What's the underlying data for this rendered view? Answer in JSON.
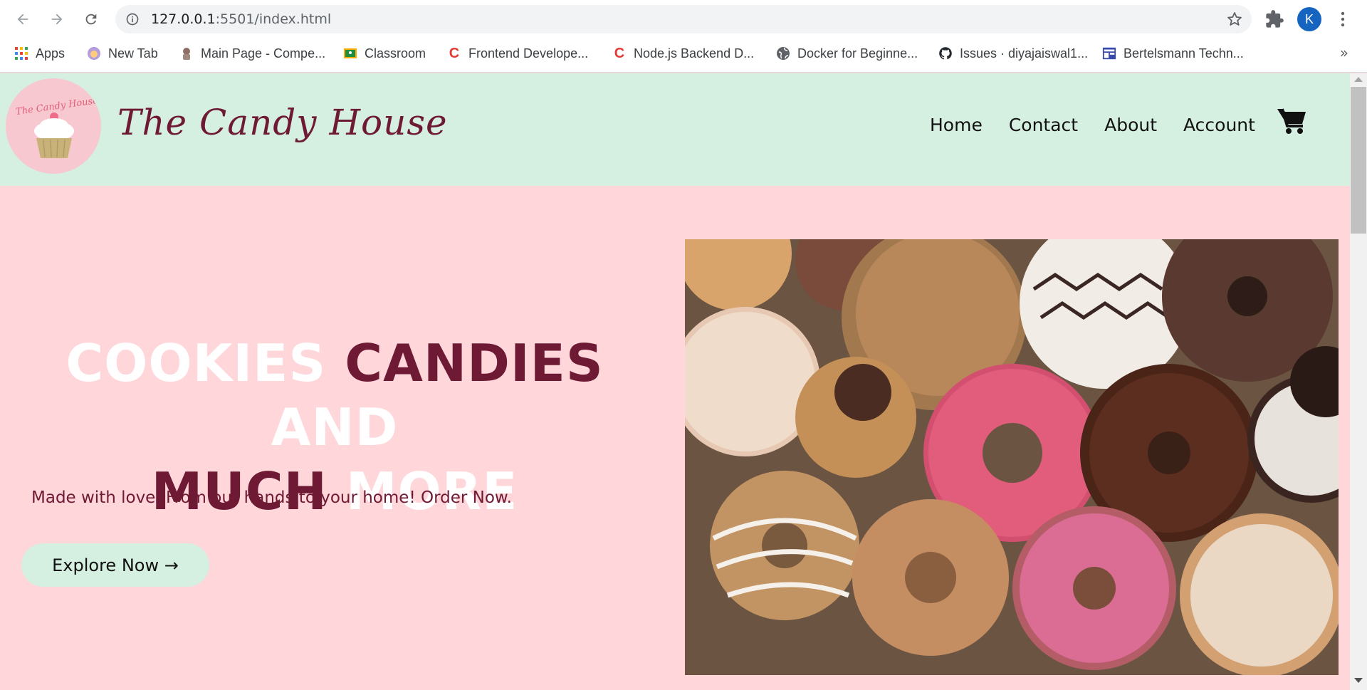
{
  "browser": {
    "url_host": "127.0.0.1",
    "url_rest": ":5501/index.html",
    "profile_initial": "K",
    "bookmarks": [
      {
        "label": "Apps",
        "icon": "apps-grid-icon"
      },
      {
        "label": "New Tab",
        "icon": "new-tab-icon"
      },
      {
        "label": "Main Page - Compe...",
        "icon": "main-page-icon"
      },
      {
        "label": "Classroom",
        "icon": "classroom-icon"
      },
      {
        "label": "Frontend Develope...",
        "icon": "frontend-c-icon"
      },
      {
        "label": "Node.js Backend D...",
        "icon": "nodejs-c-icon"
      },
      {
        "label": "Docker for Beginne...",
        "icon": "globe-icon"
      },
      {
        "label": "Issues · diyajaiswal1...",
        "icon": "github-icon"
      },
      {
        "label": "Bertelsmann Techn...",
        "icon": "bertelsmann-icon"
      }
    ],
    "more_bookmarks": "»"
  },
  "site": {
    "logo_text": "The Candy House",
    "brand_name": "The Candy House",
    "nav": [
      "Home",
      "Contact",
      "About",
      "Account"
    ],
    "cart_icon": "cart-icon"
  },
  "hero": {
    "title_words": [
      "COOKIES",
      "CANDIES",
      "AND",
      "MUCH",
      "MORE"
    ],
    "subtitle": "Made with love. From our hands to your home! Order Now.",
    "button_label": "Explore Now →",
    "image_alt": "donuts-photo"
  },
  "colors": {
    "page_bg": "#ffd6d9",
    "header_bg": "#d5efe1",
    "accent_maroon": "#6e1a35",
    "button_bg": "#d5efe1"
  }
}
